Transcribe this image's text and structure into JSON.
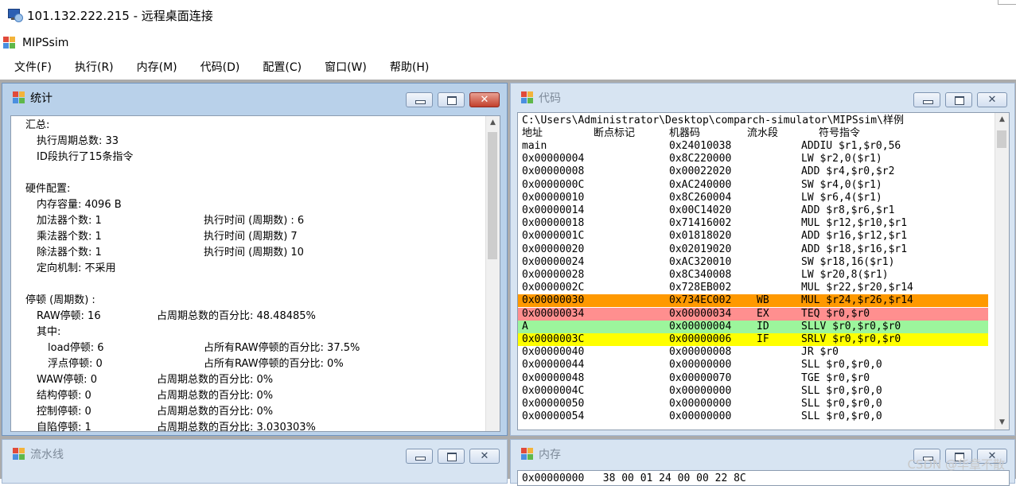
{
  "remote_desktop": {
    "title": "101.132.222.215 - 远程桌面连接"
  },
  "app": {
    "title": "MIPSsim"
  },
  "menu": [
    "文件(F)",
    "执行(R)",
    "内存(M)",
    "代码(D)",
    "配置(C)",
    "窗口(W)",
    "帮助(H)"
  ],
  "windows": {
    "stats": {
      "title": "统计"
    },
    "code": {
      "title": "代码"
    },
    "pipeline": {
      "title": "流水线"
    },
    "memory": {
      "title": "内存",
      "first_line": "0x00000000   38 00 01 24 00 00 22 8C"
    }
  },
  "stats": {
    "summary_label": "汇总:",
    "total_cycles": "执行周期总数: 33",
    "id_exec": "ID段执行了15条指令",
    "hw_label": "硬件配置:",
    "mem_size": "内存容量: 4096 B",
    "adder_count": "加法器个数: 1",
    "adder_time": "执行时间 (周期数) : 6",
    "mult_count": "乘法器个数: 1",
    "mult_time": "执行时间 (周期数) 7",
    "div_count": "除法器个数: 1",
    "div_time": "执行时间 (周期数) 10",
    "forwarding": "定向机制: 不采用",
    "stall_label": "停顿 (周期数) :",
    "raw": "RAW停顿: 16",
    "raw_pct": "占周期总数的百分比: 48.48485%",
    "among": "其中:",
    "load": "load停顿: 6",
    "load_pct": "占所有RAW停顿的百分比: 37.5%",
    "fp": "浮点停顿: 0",
    "fp_pct": "占所有RAW停顿的百分比: 0%",
    "waw": "WAW停顿: 0",
    "waw_pct": "占周期总数的百分比: 0%",
    "struct": "结构停顿: 0",
    "struct_pct": "占周期总数的百分比: 0%",
    "ctrl": "控制停顿: 0",
    "ctrl_pct": "占周期总数的百分比: 0%",
    "self": "自陷停顿: 1",
    "self_pct": "占周期总数的百分比: 3.030303%"
  },
  "code": {
    "path": "C:\\Users\\Administrator\\Desktop\\comparch-simulator\\MIPSsim\\样例",
    "headers": {
      "addr": "地址",
      "bp": "断点标记",
      "mc": "机器码",
      "stage": "流水段",
      "sym": "符号指令"
    },
    "rows": [
      {
        "addr": "main",
        "mc": "0x24010038",
        "stage": "",
        "sym": "ADDIU $r1,$r0,56",
        "hl": ""
      },
      {
        "addr": "0x00000004",
        "mc": "0x8C220000",
        "stage": "",
        "sym": "LW $r2,0($r1)",
        "hl": ""
      },
      {
        "addr": "0x00000008",
        "mc": "0x00022020",
        "stage": "",
        "sym": "ADD $r4,$r0,$r2",
        "hl": ""
      },
      {
        "addr": "0x0000000C",
        "mc": "0xAC240000",
        "stage": "",
        "sym": "SW $r4,0($r1)",
        "hl": ""
      },
      {
        "addr": "0x00000010",
        "mc": "0x8C260004",
        "stage": "",
        "sym": "LW $r6,4($r1)",
        "hl": ""
      },
      {
        "addr": "0x00000014",
        "mc": "0x00C14020",
        "stage": "",
        "sym": "ADD $r8,$r6,$r1",
        "hl": ""
      },
      {
        "addr": "0x00000018",
        "mc": "0x71416002",
        "stage": "",
        "sym": "MUL $r12,$r10,$r1",
        "hl": ""
      },
      {
        "addr": "0x0000001C",
        "mc": "0x01818020",
        "stage": "",
        "sym": "ADD $r16,$r12,$r1",
        "hl": ""
      },
      {
        "addr": "0x00000020",
        "mc": "0x02019020",
        "stage": "",
        "sym": "ADD $r18,$r16,$r1",
        "hl": ""
      },
      {
        "addr": "0x00000024",
        "mc": "0xAC320010",
        "stage": "",
        "sym": "SW $r18,16($r1)",
        "hl": ""
      },
      {
        "addr": "0x00000028",
        "mc": "0x8C340008",
        "stage": "",
        "sym": "LW $r20,8($r1)",
        "hl": ""
      },
      {
        "addr": "0x0000002C",
        "mc": "0x728EB002",
        "stage": "",
        "sym": "MUL $r22,$r20,$r14",
        "hl": ""
      },
      {
        "addr": "0x00000030",
        "mc": "0x734EC002",
        "stage": "WB",
        "sym": "MUL $r24,$r26,$r14",
        "hl": "#ff9900"
      },
      {
        "addr": "0x00000034",
        "mc": "0x00000034",
        "stage": "EX",
        "sym": "TEQ $r0,$r0",
        "hl": "#ff8f8f"
      },
      {
        "addr": "A",
        "mc": "0x00000004",
        "stage": "ID",
        "sym": "SLLV $r0,$r0,$r0",
        "hl": "#9cf59c"
      },
      {
        "addr": "0x0000003C",
        "mc": "0x00000006",
        "stage": "IF",
        "sym": "SRLV $r0,$r0,$r0",
        "hl": "#ffff00"
      },
      {
        "addr": "0x00000040",
        "mc": "0x00000008",
        "stage": "",
        "sym": "JR $r0",
        "hl": ""
      },
      {
        "addr": "0x00000044",
        "mc": "0x00000000",
        "stage": "",
        "sym": "SLL $r0,$r0,0",
        "hl": ""
      },
      {
        "addr": "0x00000048",
        "mc": "0x00000070",
        "stage": "",
        "sym": "TGE $r0,$r0",
        "hl": ""
      },
      {
        "addr": "0x0000004C",
        "mc": "0x00000000",
        "stage": "",
        "sym": "SLL $r0,$r0,0",
        "hl": ""
      },
      {
        "addr": "0x00000050",
        "mc": "0x00000000",
        "stage": "",
        "sym": "SLL $r0,$r0,0",
        "hl": ""
      },
      {
        "addr": "0x00000054",
        "mc": "0x00000000",
        "stage": "",
        "sym": "SLL $r0,$r0,0",
        "hl": ""
      }
    ]
  },
  "watermark": "CSDN @华章不散"
}
